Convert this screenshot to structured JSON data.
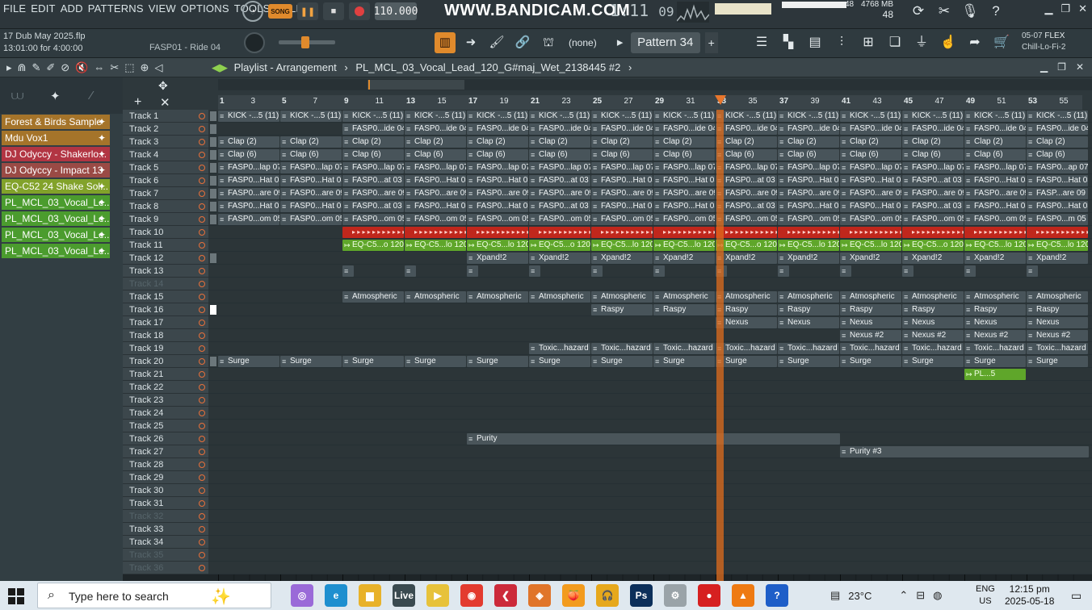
{
  "menu": [
    "FILE",
    "EDIT",
    "ADD",
    "PATTERNS",
    "VIEW",
    "OPTIONS",
    "TOOLS",
    "HELP"
  ],
  "transport": {
    "song_label": "SONG",
    "tempo": "110.000",
    "time": "1:11",
    "time_sub": "09"
  },
  "watermark": "WWW.BANDICAM.COM",
  "memory": {
    "cpu": "48",
    "mem": "4768 MB",
    "poly": "48"
  },
  "file": {
    "name": "17 Dub May 2025.flp",
    "time": "13:01:00 for 4:00:00",
    "hint": "FASP01 - Ride 04"
  },
  "toolbar": {
    "none_label": "(none)",
    "pattern": "Pattern 34"
  },
  "news": {
    "date": "05-07",
    "tag": "FLEX",
    "name": "Chill-Lo-Fi-2"
  },
  "playlist": {
    "title": "Playlist - Arrangement",
    "path": "PL_MCL_03_Vocal_Lead_120_G#maj_Wet_2138445 #2"
  },
  "browser": [
    {
      "label": "Forest & Birds Sample",
      "color": "#a5742a"
    },
    {
      "label": "Mdu Vox1",
      "color": "#a5742a"
    },
    {
      "label": "DJ Odyccy - Shakerlo...",
      "color": "#b23543"
    },
    {
      "label": "DJ Odyccy - Impact 13",
      "color": "#9a4a45"
    },
    {
      "label": "EQ-C52 24 Shake Sol...",
      "color": "#82a22a"
    },
    {
      "label": "PL_MCL_03_Vocal_Le...",
      "color": "#4b9c2e"
    },
    {
      "label": "PL_MCL_03_Vocal_Le...",
      "color": "#4b9c2e"
    },
    {
      "label": "PL_MCL_03_Vocal_Le...",
      "color": "#4b9c2e"
    },
    {
      "label": "PL_MCL_03_Vocal_Le...",
      "color": "#4b9c2e"
    }
  ],
  "ruler": [
    "1",
    "3",
    "5",
    "7",
    "9",
    "11",
    "13",
    "15",
    "17",
    "19",
    "21",
    "23",
    "25",
    "27",
    "29",
    "31",
    "33",
    "35",
    "37",
    "39",
    "41",
    "43",
    "45",
    "47",
    "49",
    "51",
    "53",
    "55"
  ],
  "tracks": [
    "Track 1",
    "Track 2",
    "Track 3",
    "Track 4",
    "Track 5",
    "Track 6",
    "Track 7",
    "Track 8",
    "Track 9",
    "Track 10",
    "Track 11",
    "Track 12",
    "Track 13",
    "Track 14",
    "Track 15",
    "Track 16",
    "Track 17",
    "Track 18",
    "Track 19",
    "Track 20",
    "Track 21",
    "Track 22",
    "Track 23",
    "Track 24",
    "Track 25",
    "Track 26",
    "Track 27",
    "Track 28",
    "Track 29",
    "Track 30",
    "Track 31",
    "Track 32",
    "Track 33",
    "Track 34",
    "Track 35",
    "Track 36"
  ],
  "dim_tracks": [
    13,
    31,
    34,
    35
  ],
  "clips": [
    {
      "row": 0,
      "label": "KICK -...5 (11)",
      "start": 0,
      "end": 14,
      "kind": "slim"
    },
    {
      "row": 1,
      "label": "FASP0...ide 04",
      "start": 2,
      "end": 14,
      "kind": "slim"
    },
    {
      "row": 2,
      "label": "Clap (2)",
      "start": 0,
      "end": 14,
      "kind": "slim"
    },
    {
      "row": 3,
      "label": "Clap (6)",
      "start": 0,
      "end": 14,
      "kind": "slim"
    },
    {
      "row": 4,
      "label": "FASP0...lap 07",
      "start": 0,
      "end": 14,
      "kind": "slim",
      "last": "FASP0...ap 07"
    },
    {
      "row": 5,
      "label": "FASP0...Hat 03",
      "start": 0,
      "end": 14,
      "kind": "slim",
      "alt": "FASP0...at 03"
    },
    {
      "row": 6,
      "label": "FASP0...are 09",
      "start": 0,
      "end": 14,
      "kind": "slim",
      "last": "FASP...are 09"
    },
    {
      "row": 7,
      "label": "FASP0...Hat 03",
      "start": 0,
      "end": 14,
      "kind": "slim",
      "alt": "FASP0...at 03"
    },
    {
      "row": 8,
      "label": "FASP0...om 05",
      "start": 0,
      "end": 14,
      "kind": "slim",
      "last": "FASP0...m 05"
    },
    {
      "row": 9,
      "label": "",
      "start": 2,
      "end": 14,
      "kind": "red"
    },
    {
      "row": 10,
      "label": "EQ-C5...lo 120",
      "start": 2,
      "end": 14,
      "kind": "green",
      "alt": "EQ-C5...o 120"
    },
    {
      "row": 11,
      "label": "Xpand!2",
      "start": 4,
      "end": 14,
      "kind": "slim"
    },
    {
      "row": 12,
      "label": "",
      "start": 2,
      "end": 14,
      "kind": "stub"
    },
    {
      "row": 14,
      "label": "Atmospheric",
      "start": 2,
      "end": 14,
      "kind": "slim"
    },
    {
      "row": 15,
      "label": "Raspy",
      "start": 6,
      "end": 14,
      "kind": "slim"
    },
    {
      "row": 16,
      "label": "Nexus",
      "start": 8,
      "end": 14,
      "kind": "slim"
    },
    {
      "row": 17,
      "label": "Nexus #2",
      "start": 10,
      "end": 14,
      "kind": "slim"
    },
    {
      "row": 18,
      "label": "Toxic...hazard",
      "start": 5,
      "end": 14,
      "kind": "slim"
    },
    {
      "row": 19,
      "label": "Surge",
      "start": 0,
      "end": 14,
      "kind": "slim"
    },
    {
      "row": 20,
      "label": "PL...5",
      "start": 12,
      "end": 13,
      "kind": "green"
    },
    {
      "row": 25,
      "label": "Purity",
      "start": 4,
      "end": 10,
      "kind": "long"
    },
    {
      "row": 26,
      "label": "Purity #3",
      "start": 10,
      "end": 14,
      "kind": "long"
    }
  ],
  "taskbar": {
    "search": "Type here to search",
    "temp": "23°C",
    "lang1": "ENG",
    "lang2": "US",
    "time": "12:15 pm",
    "date": "2025-05-18"
  }
}
